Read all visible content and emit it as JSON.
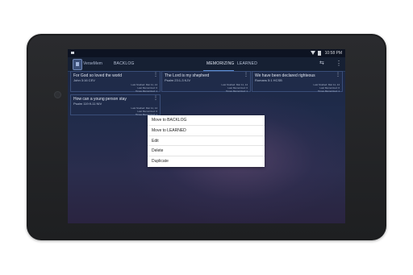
{
  "status_bar": {
    "time": "10:58 PM"
  },
  "app": {
    "title": "VerseMem"
  },
  "tabs": [
    {
      "label": "BACKLOG",
      "active": false
    },
    {
      "label": "MEMORIZING",
      "active": true
    },
    {
      "label": "LEARNED",
      "active": false
    }
  ],
  "cards": [
    {
      "title": "For God so loved the world",
      "ref": "John 3:16  CEV",
      "meta": [
        "Last Studied: Mar 11, 14",
        "Last Memorized: 0",
        "Times Memorized: 1"
      ]
    },
    {
      "title": "The Lord is my shepherd",
      "ref": "Psalm 23:1-3  KJV",
      "meta": [
        "Last Studied: Mar 11, 14",
        "Last Memorized: 0",
        "Times Memorized: 1"
      ]
    },
    {
      "title": "We have been declared righteous",
      "ref": "Romans 5:1  HCSB",
      "meta": [
        "Last Studied: Mar 11, 14",
        "Last Memorized: 0",
        "Times Memorized: 1"
      ]
    },
    {
      "title": "How can a young person stay",
      "ref": "Psalm 119:9-11  NIV",
      "meta": [
        "Last Studied: Mar 11, 14",
        "Last Memorized: 0",
        "Times Memorized: 1"
      ]
    }
  ],
  "context_menu": {
    "items": [
      "Move to BACKLOG",
      "Move to LEARNED",
      "Edit",
      "Delete",
      "Duplicate"
    ]
  },
  "icons": {
    "notification": "notification-icon",
    "wifi": "wifi-icon",
    "battery": "battery-icon",
    "route": "route-icon",
    "overflow": "overflow-menu-icon"
  },
  "colors": {
    "accent": "#5d8fd8",
    "action_bar": "#162033",
    "card_bg": "#202c4a",
    "menu_bg": "#ffffff"
  }
}
